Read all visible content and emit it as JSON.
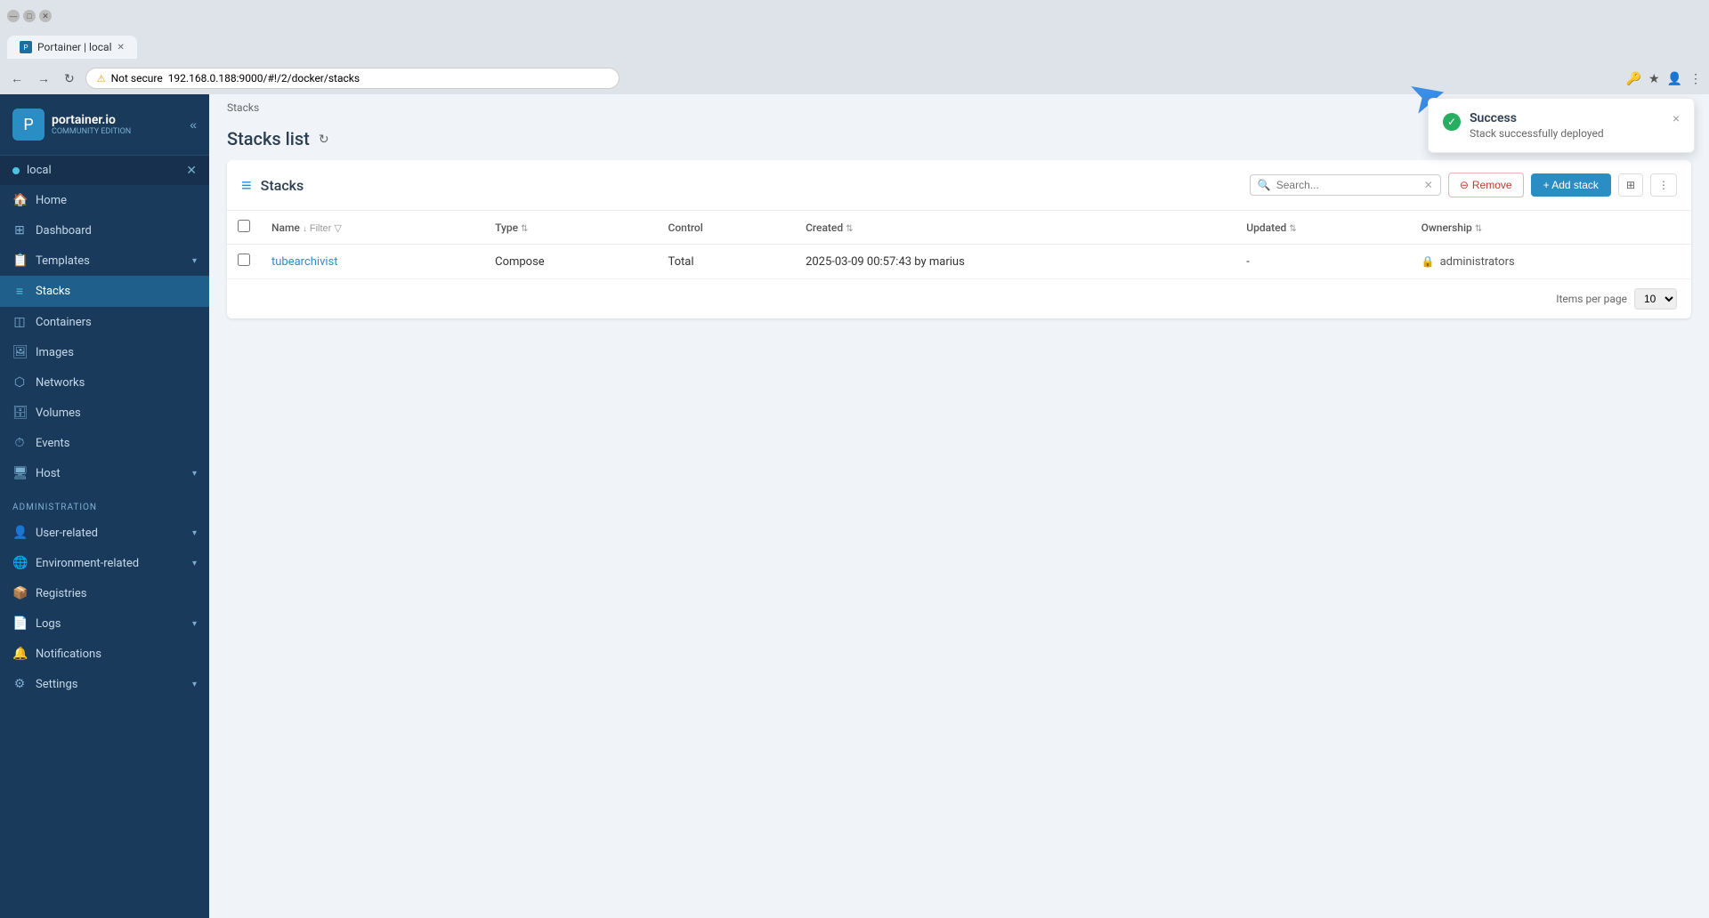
{
  "browser": {
    "tab_title": "Portainer | local",
    "address": "192.168.0.188:9000/#!/2/docker/stacks",
    "secure_label": "Not secure"
  },
  "sidebar": {
    "logo_text": "portainer.io",
    "logo_subtext": "COMMUNITY EDITION",
    "env_name": "local",
    "nav_items": [
      {
        "id": "home",
        "label": "Home",
        "icon": "🏠"
      },
      {
        "id": "dashboard",
        "label": "Dashboard",
        "icon": "📊"
      },
      {
        "id": "templates",
        "label": "Templates",
        "icon": "📋",
        "hasChevron": true
      },
      {
        "id": "stacks",
        "label": "Stacks",
        "icon": "📦",
        "active": true
      },
      {
        "id": "containers",
        "label": "Containers",
        "icon": "🗳"
      },
      {
        "id": "images",
        "label": "Images",
        "icon": "🖼"
      },
      {
        "id": "networks",
        "label": "Networks",
        "icon": "🔗"
      },
      {
        "id": "volumes",
        "label": "Volumes",
        "icon": "💾"
      },
      {
        "id": "events",
        "label": "Events",
        "icon": "⏱"
      },
      {
        "id": "host",
        "label": "Host",
        "icon": "🖥",
        "hasChevron": true
      }
    ],
    "admin_label": "Administration",
    "admin_items": [
      {
        "id": "user-related",
        "label": "User-related",
        "icon": "👤",
        "hasChevron": true
      },
      {
        "id": "environment-related",
        "label": "Environment-related",
        "icon": "🌐",
        "hasChevron": true
      },
      {
        "id": "registries",
        "label": "Registries",
        "icon": "📦"
      },
      {
        "id": "logs",
        "label": "Logs",
        "icon": "📄",
        "hasChevron": true
      },
      {
        "id": "notifications",
        "label": "Notifications",
        "icon": "🔔"
      },
      {
        "id": "settings",
        "label": "Settings",
        "icon": "⚙",
        "hasChevron": true
      }
    ]
  },
  "breadcrumb": "Stacks",
  "page_title": "Stacks list",
  "table": {
    "title": "Stacks",
    "search_placeholder": "Search...",
    "remove_label": "Remove",
    "add_label": "+ Add stack",
    "columns": [
      {
        "id": "name",
        "label": "Name",
        "sortable": true
      },
      {
        "id": "type",
        "label": "Type",
        "sortable": true
      },
      {
        "id": "control",
        "label": "Control"
      },
      {
        "id": "created",
        "label": "Created",
        "sortable": true
      },
      {
        "id": "updated",
        "label": "Updated",
        "sortable": true
      },
      {
        "id": "ownership",
        "label": "Ownership",
        "sortable": true
      }
    ],
    "rows": [
      {
        "name": "tubearchivist",
        "type": "Compose",
        "control": "Total",
        "created": "2025-03-09 00:57:43 by marius",
        "updated": "-",
        "ownership": "administrators"
      }
    ],
    "items_per_page_label": "Items per page",
    "items_per_page_value": "10",
    "filter_label": "Filter"
  },
  "toast": {
    "title": "Success",
    "message": "Stack successfully deployed",
    "close_label": "×"
  }
}
